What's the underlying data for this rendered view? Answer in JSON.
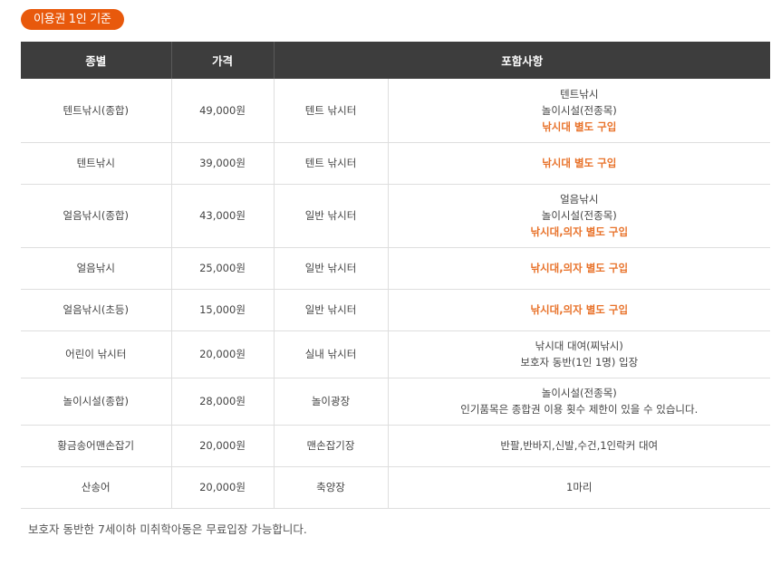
{
  "badge": "이용권 1인 기준",
  "table": {
    "headers": [
      "종별",
      "가격",
      "포함사항"
    ],
    "rows": [
      {
        "type": "텐트낚시(종합)",
        "price": "49,000원",
        "place": "텐트 낚시터",
        "includes": [
          {
            "text": "텐트낚시",
            "highlight": false
          },
          {
            "text": "놀이시설(전종목)",
            "highlight": false
          },
          {
            "text": "낚시대 별도 구입",
            "highlight": true
          }
        ]
      },
      {
        "type": "텐트낚시",
        "price": "39,000원",
        "place": "텐트 낚시터",
        "includes": [
          {
            "text": "낚시대 별도 구입",
            "highlight": true
          }
        ]
      },
      {
        "type": "얼음낚시(종합)",
        "price": "43,000원",
        "place": "일반 낚시터",
        "includes": [
          {
            "text": "얼음낚시",
            "highlight": false
          },
          {
            "text": "놀이시설(전종목)",
            "highlight": false
          },
          {
            "text": "낚시대,의자 별도 구입",
            "highlight": true
          }
        ]
      },
      {
        "type": "얼음낚시",
        "price": "25,000원",
        "place": "일반 낚시터",
        "includes": [
          {
            "text": "낚시대,의자 별도 구입",
            "highlight": true
          }
        ]
      },
      {
        "type": "얼음낚시(초등)",
        "price": "15,000원",
        "place": "일반 낚시터",
        "includes": [
          {
            "text": "낚시대,의자 별도 구입",
            "highlight": true
          }
        ]
      },
      {
        "type": "어린이 낚시터",
        "price": "20,000원",
        "place": "실내 낚시터",
        "includes": [
          {
            "text": "낚시대 대여(찌낚시)",
            "highlight": false
          },
          {
            "text": "보호자 동반(1인 1명) 입장",
            "highlight": false
          }
        ]
      },
      {
        "type": "놀이시설(종합)",
        "price": "28,000원",
        "place": "놀이광장",
        "includes": [
          {
            "text": "놀이시설(전종목)",
            "highlight": false
          },
          {
            "text": "인기품목은 종합권 이용 횟수 제한이 있을 수 있습니다.",
            "highlight": false
          }
        ]
      },
      {
        "type": "황금송어맨손잡기",
        "price": "20,000원",
        "place": "맨손잡기장",
        "includes": [
          {
            "text": "반팔,반바지,신발,수건,1인락커 대여",
            "highlight": false
          }
        ]
      },
      {
        "type": "산송어",
        "price": "20,000원",
        "place": "축양장",
        "includes": [
          {
            "text": "1마리",
            "highlight": false
          }
        ]
      }
    ]
  },
  "note": "보호자 동반한 7세이하 미취학아동은 무료입장 가능합니다.",
  "colors": {
    "accent": "#e8590c",
    "highlight_text": "#e8722a",
    "header_bg": "#3d3d3d"
  }
}
